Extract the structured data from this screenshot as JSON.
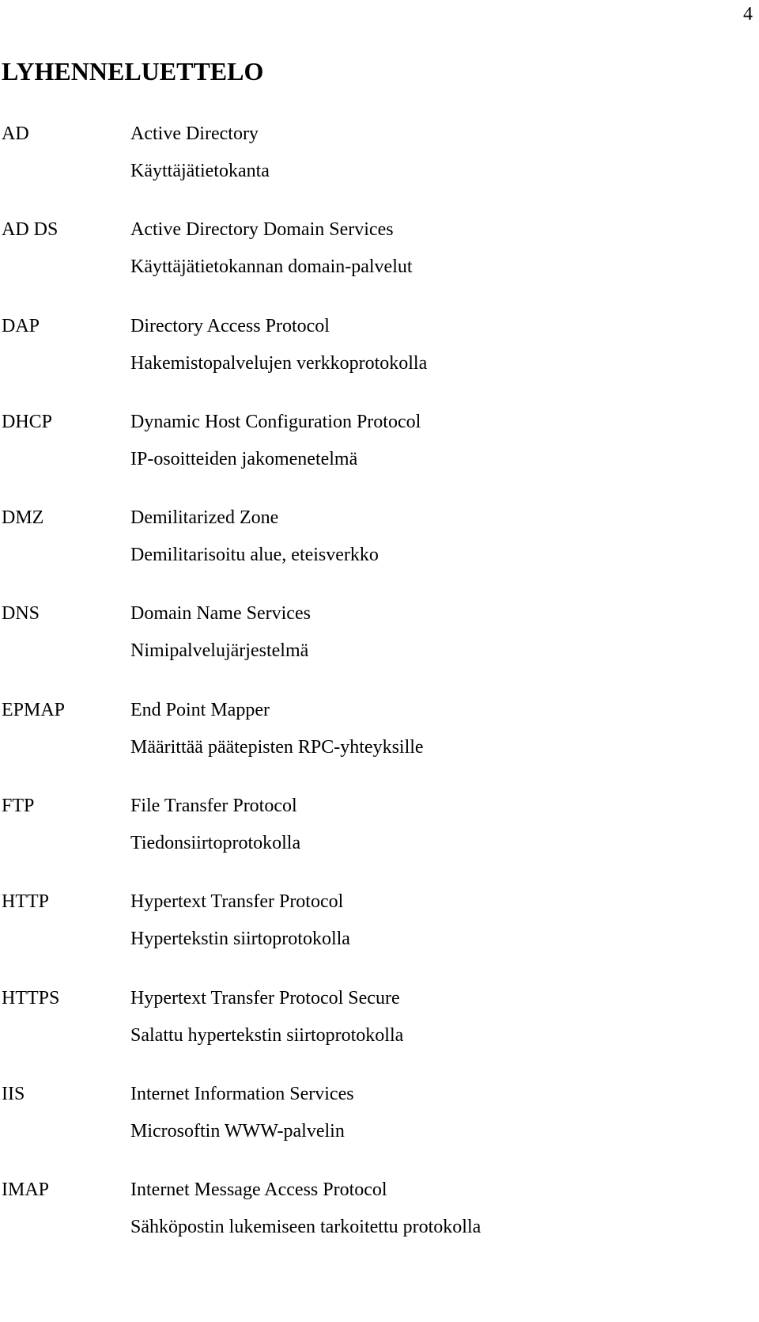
{
  "page": {
    "number": "4",
    "heading": "LYHENNELUETTELO"
  },
  "entries": [
    {
      "abbr": "AD",
      "english": "Active Directory",
      "finnish": "Käyttäjätietokanta"
    },
    {
      "abbr": "AD DS",
      "english": "Active Directory Domain Services",
      "finnish": "Käyttäjätietokannan domain-palvelut"
    },
    {
      "abbr": "DAP",
      "english": "Directory Access Protocol",
      "finnish": "Hakemistopalvelujen verkkoprotokolla"
    },
    {
      "abbr": "DHCP",
      "english": "Dynamic Host Configuration Protocol",
      "finnish": "IP-osoitteiden jakomenetelmä"
    },
    {
      "abbr": "DMZ",
      "english": "Demilitarized Zone",
      "finnish": "Demilitarisoitu alue, eteisverkko"
    },
    {
      "abbr": "DNS",
      "english": "Domain Name Services",
      "finnish": "Nimipalvelujärjestelmä"
    },
    {
      "abbr": "EPMAP",
      "english": "End Point Mapper",
      "finnish": "Määrittää päätepisten RPC-yhteyksille"
    },
    {
      "abbr": "FTP",
      "english": "File Transfer Protocol",
      "finnish": "Tiedonsiirtoprotokolla"
    },
    {
      "abbr": "HTTP",
      "english": "Hypertext Transfer Protocol",
      "finnish": "Hypertekstin siirtoprotokolla"
    },
    {
      "abbr": "HTTPS",
      "english": "Hypertext Transfer Protocol Secure",
      "finnish": "Salattu hypertekstin siirtoprotokolla"
    },
    {
      "abbr": "IIS",
      "english": "Internet Information Services",
      "finnish": "Microsoftin WWW-palvelin"
    },
    {
      "abbr": "IMAP",
      "english": "Internet Message Access Protocol",
      "finnish": "Sähköpostin lukemiseen tarkoitettu protokolla"
    }
  ]
}
